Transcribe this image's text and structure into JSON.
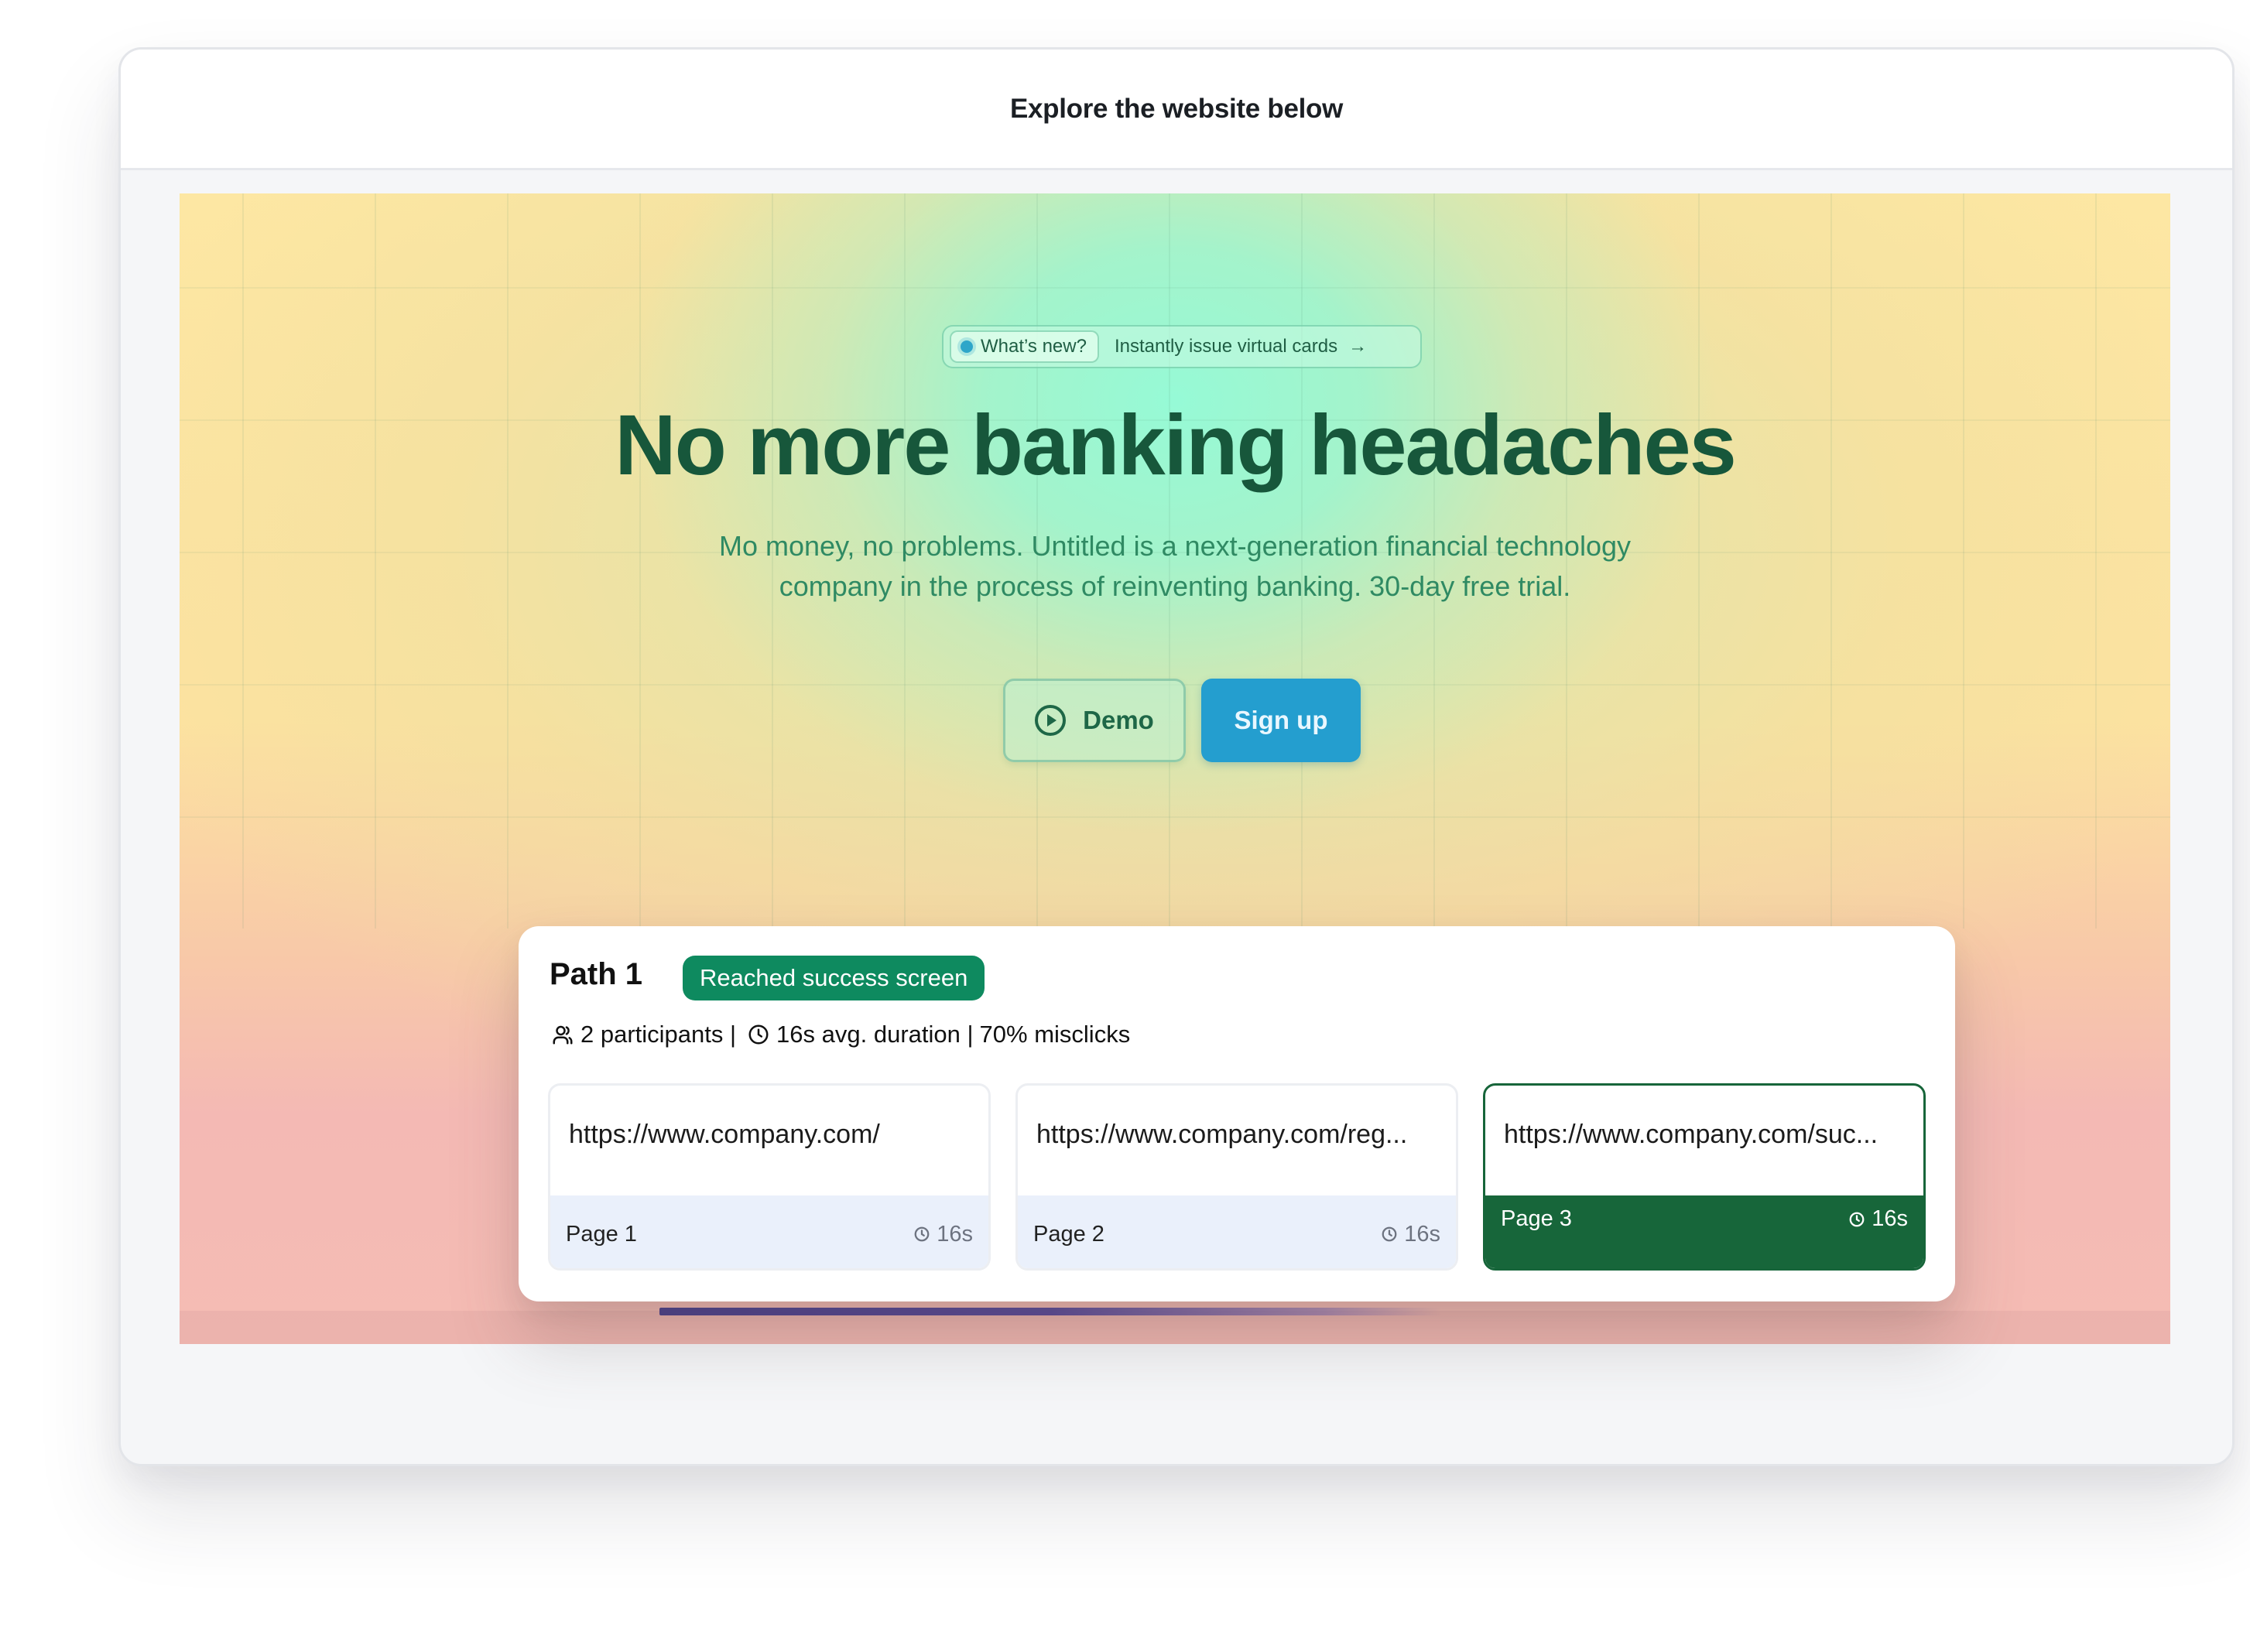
{
  "frame": {
    "title": "Explore the website below"
  },
  "hero": {
    "pill_tag": "What’s new?",
    "pill_text": "Instantly issue virtual cards",
    "title": "No more banking headaches",
    "subtitle_line1": "Mo money, no problems. Untitled is a next-generation financial technology",
    "subtitle_line2": "company in the process of reinventing banking. 30-day free trial.",
    "demo_label": "Demo",
    "signup_label": "Sign up"
  },
  "path": {
    "title": "Path 1",
    "badge": "Reached success screen",
    "participants": "2 participants |",
    "duration": "16s avg. duration |",
    "misclicks": "70% misclicks",
    "pages": [
      {
        "url": "https://www.company.com/",
        "label": "Page 1",
        "duration": "16s"
      },
      {
        "url": "https://www.company.com/reg...",
        "label": "Page 2",
        "duration": "16s"
      },
      {
        "url": "https://www.company.com/suc...",
        "label": "Page 3",
        "duration": "16s"
      }
    ]
  },
  "colors": {
    "brand_green": "#17573b",
    "success_badge": "#0e8a5f",
    "active_page": "#17663a",
    "signup_button": "#249ecf"
  },
  "icons": {
    "pill": "status-dot-icon",
    "pill_arrow": "arrow-right-icon",
    "demo": "play-circle-icon",
    "participants": "users-icon",
    "duration": "clock-icon"
  }
}
